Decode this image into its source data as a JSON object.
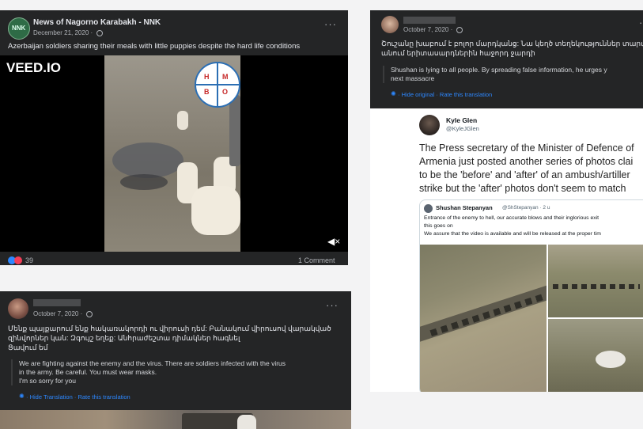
{
  "post1": {
    "avatar_text": "NNK",
    "page_name": "News of Nagorno Karabakh - NNK",
    "date": "December 21, 2020 · ",
    "menu": "···",
    "caption": "Azerbaijan soldiers sharing their meals with little puppies despite the hard life conditions",
    "watermark": "VEED.IO",
    "logo_letters": [
      "H",
      "M",
      "B",
      "O"
    ],
    "reaction_count": "39",
    "comments": "1 Comment",
    "colors": {
      "card": "#242526",
      "video_bg": "#000000"
    }
  },
  "post2": {
    "date": "October 7, 2020 · ",
    "menu": "···",
    "text_line1": "Մենք պայքարում ենք հակառակորդի ու վիրուսի դեմ: Բանակում վիրուսով վարակված",
    "text_line2": "զինվորներ կան: Զգույշ եղեք: Անհրաժեշտա դիմակներ հագնել",
    "text_line3": "Ցավում եմ",
    "translation_line1": "We are fighting against the enemy and the virus. There are soldiers infected with the virus",
    "translation_line2": "in the army. Be careful. You must wear masks.",
    "translation_line3": "I'm so sorry for you",
    "hide_translation": "· Hide Translation · Rate this translation"
  },
  "post3": {
    "date": "October 7, 2020 · ",
    "menu": "···",
    "text_line1": "Շուշանը խաբում է բոլոր մարդկանց: Նա կեղծ տեղեկություններ տարածելով",
    "text_line2": "անում երիտասարդներին հաջորդ ջարդի",
    "translation_line1": "Shushan is lying to all people. By spreading false information, he urges y",
    "translation_line2": "next massacre",
    "hide_original": "· Hide original · Rate this translation",
    "tweet": {
      "author": "Kyle Glen",
      "handle": "@KyleJGlen",
      "line1": "The Press secretary of the Minister of Defence of",
      "line2": "Armenia just posted another series of photos clai",
      "line3": "to be the 'before' and 'after' of an ambush/artiller",
      "line4": "strike but the 'after' photos don't seem to match",
      "quoted_author": "Shushan Stepanyan",
      "quoted_handle": "@ShStepanyan · 2 u",
      "quoted_line1": "Entrance of the enemy to hell, our accurate blows and their inglorious exit",
      "quoted_line2": "this goes on",
      "quoted_line3": "We assure that the video is available and will be released at the proper tim"
    }
  }
}
